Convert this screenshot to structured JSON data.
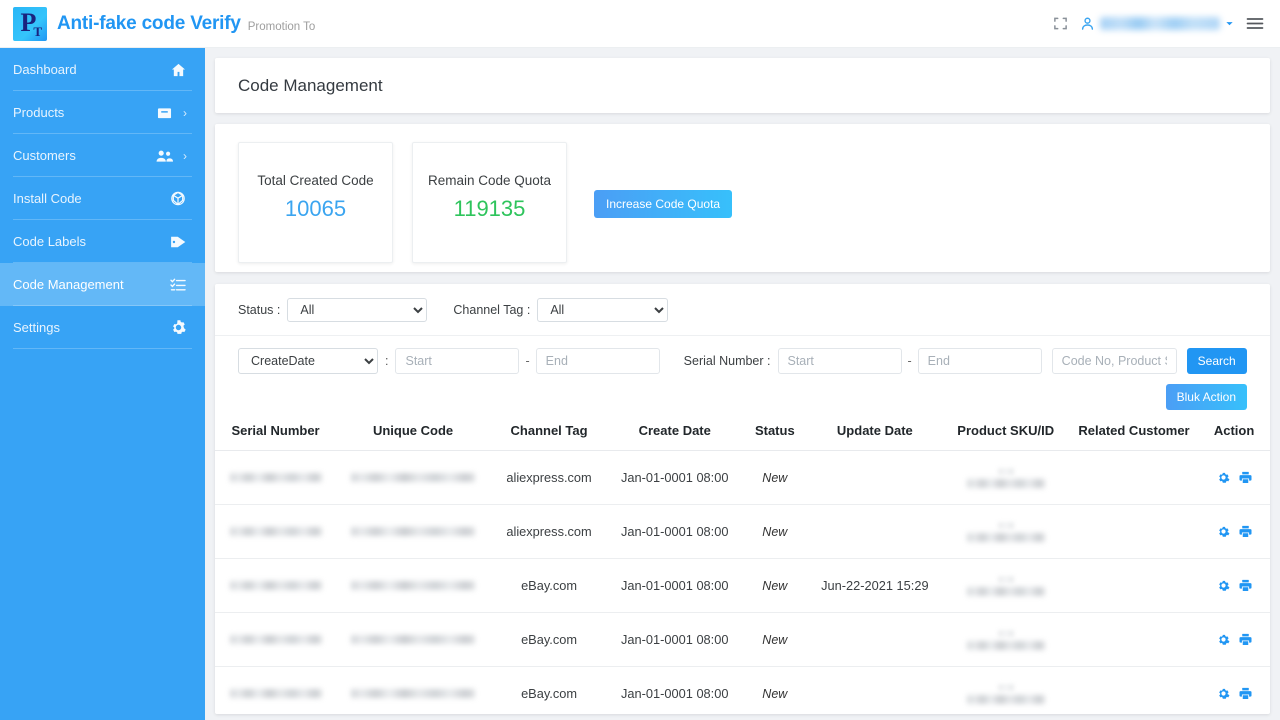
{
  "header": {
    "brand_title": "Anti-fake code Verify",
    "brand_sub": "Promotion To",
    "logo_letter_main": "P",
    "logo_letter_sub": "T",
    "fullscreen_icon": "fullscreen-icon",
    "user_icon": "user-icon",
    "user_name": "",
    "dropdown_icon": "chevron-down-icon",
    "menu_icon": "hamburger-menu-icon"
  },
  "sidebar": {
    "items": [
      {
        "label": "Dashboard",
        "icon": "home-icon",
        "has_chevron": false,
        "active": false
      },
      {
        "label": "Products",
        "icon": "box-icon",
        "has_chevron": true,
        "active": false
      },
      {
        "label": "Customers",
        "icon": "users-icon",
        "has_chevron": true,
        "active": false
      },
      {
        "label": "Install Code",
        "icon": "cube-icon",
        "has_chevron": false,
        "active": false
      },
      {
        "label": "Code Labels",
        "icon": "tags-icon",
        "has_chevron": false,
        "active": false
      },
      {
        "label": "Code Management",
        "icon": "list-check-icon",
        "has_chevron": false,
        "active": true
      },
      {
        "label": "Settings",
        "icon": "gear-icon",
        "has_chevron": false,
        "active": false
      }
    ]
  },
  "main": {
    "page_title": "Code Management",
    "stats": [
      {
        "label": "Total Created Code",
        "value": "10065",
        "color": "#3ba5f0"
      },
      {
        "label": "Remain Code Quota",
        "value": "119135",
        "color": "#2ec45c"
      }
    ],
    "quota_button": "Increase Code Quota",
    "filters": {
      "status_label": "Status :",
      "status_value": "All",
      "channel_label": "Channel Tag :",
      "channel_value": "All",
      "date_field_value": "CreateDate",
      "colon": ":",
      "dash": "-",
      "date_start_placeholder": "Start",
      "date_end_placeholder": "End",
      "serial_label": "Serial Number :",
      "serial_start_placeholder": "Start",
      "serial_end_placeholder": "End",
      "keyword_placeholder": "Code No, Product SKU o",
      "search_button": "Search",
      "bulk_button": "Bluk Action"
    },
    "table": {
      "columns": [
        "Serial Number",
        "Unique Code",
        "Channel Tag",
        "Create Date",
        "Status",
        "Update Date",
        "Product SKU/ID",
        "Related Customer",
        "Action"
      ],
      "rows": [
        {
          "serial": "",
          "unique_code": "",
          "channel_tag": "aliexpress.com",
          "create_date": "Jan-01-0001 08:00",
          "status": "New",
          "update_date": "",
          "product_sku": "",
          "related_customer": "",
          "actions": [
            "gear-icon",
            "print-icon"
          ]
        },
        {
          "serial": "",
          "unique_code": "",
          "channel_tag": "aliexpress.com",
          "create_date": "Jan-01-0001 08:00",
          "status": "New",
          "update_date": "",
          "product_sku": "",
          "related_customer": "",
          "actions": [
            "gear-icon",
            "print-icon"
          ]
        },
        {
          "serial": "",
          "unique_code": "",
          "channel_tag": "eBay.com",
          "create_date": "Jan-01-0001 08:00",
          "status": "New",
          "update_date": "Jun-22-2021 15:29",
          "product_sku": "",
          "related_customer": "",
          "actions": [
            "gear-icon",
            "print-icon"
          ]
        },
        {
          "serial": "",
          "unique_code": "",
          "channel_tag": "eBay.com",
          "create_date": "Jan-01-0001 08:00",
          "status": "New",
          "update_date": "",
          "product_sku": "",
          "related_customer": "",
          "actions": [
            "gear-icon",
            "print-icon"
          ]
        },
        {
          "serial": "",
          "unique_code": "",
          "channel_tag": "eBay.com",
          "create_date": "Jan-01-0001 08:00",
          "status": "New",
          "update_date": "",
          "product_sku": "",
          "related_customer": "",
          "actions": [
            "gear-icon",
            "print-icon"
          ]
        }
      ]
    }
  },
  "colors": {
    "sidebar_bg": "#37a3f5",
    "sidebar_active": "#63b8f7",
    "accent_blue": "#2196f3",
    "stat_blue": "#3ba5f0",
    "stat_green": "#2ec45c",
    "page_bg": "#f0f2f5"
  }
}
